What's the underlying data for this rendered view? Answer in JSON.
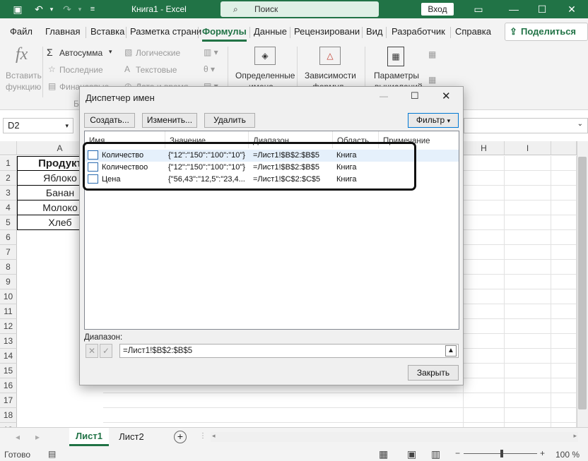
{
  "titlebar": {
    "title": "Книга1 - Excel",
    "search": "Поиск",
    "login": "Вход"
  },
  "tabs": [
    "Файл",
    "Главная",
    "Вставка",
    "Разметка страни",
    "Формулы",
    "Данные",
    "Рецензировани",
    "Вид",
    "Разработчик",
    "Справка"
  ],
  "share": "Поделиться",
  "ribbon": {
    "insert_function": [
      "Вставить",
      "функцию"
    ],
    "autosum": "Автосумма",
    "recent": "Последние",
    "financial": "Финансовые",
    "logical": "Логические",
    "text": "Текстовые",
    "date_time": "Дата и время",
    "defined_names": [
      "Определенные",
      "имена"
    ],
    "dependencies": [
      "Зависимости",
      "формул"
    ],
    "calc_options": [
      "Параметры",
      "вычислений"
    ],
    "group_label": "Би"
  },
  "namebox": "D2",
  "columns": [
    "A",
    "H",
    "I"
  ],
  "rows": [
    "1",
    "2",
    "3",
    "4",
    "5",
    "6",
    "7",
    "8",
    "9",
    "10",
    "11",
    "12",
    "13",
    "14",
    "15",
    "16",
    "17",
    "18",
    "19"
  ],
  "cells": [
    "Продукт",
    "Яблоко",
    "Банан",
    "Молоко",
    "Хлеб"
  ],
  "sheets": [
    "Лист1",
    "Лист2"
  ],
  "status": {
    "ready": "Готово",
    "zoom": "100 %"
  },
  "dialog": {
    "title": "Диспетчер имен",
    "buttons": {
      "create": "Создать...",
      "edit": "Изменить...",
      "delete": "Удалить",
      "filter": "Фильтр",
      "close": "Закрыть"
    },
    "headers": [
      "Имя",
      "Значение",
      "Диапазон",
      "Область",
      "Примечание"
    ],
    "rows": [
      {
        "name": "Количество",
        "value": "{\"12\":\"150\":\"100\":\"10\"}",
        "range": "=Лист1!$B$2:$B$5",
        "scope": "Книга"
      },
      {
        "name": "Количествоо",
        "value": "{\"12\":\"150\":\"100\":\"10\"}",
        "range": "=Лист1!$B$2:$B$5",
        "scope": "Книга"
      },
      {
        "name": "Цена",
        "value": "{\"56,43\":\"12,5\":\"23,4...",
        "range": "=Лист1!$C$2:$C$5",
        "scope": "Книга"
      }
    ],
    "range_label": "Диапазон:",
    "range_value": "=Лист1!$B$2:$B$5"
  }
}
